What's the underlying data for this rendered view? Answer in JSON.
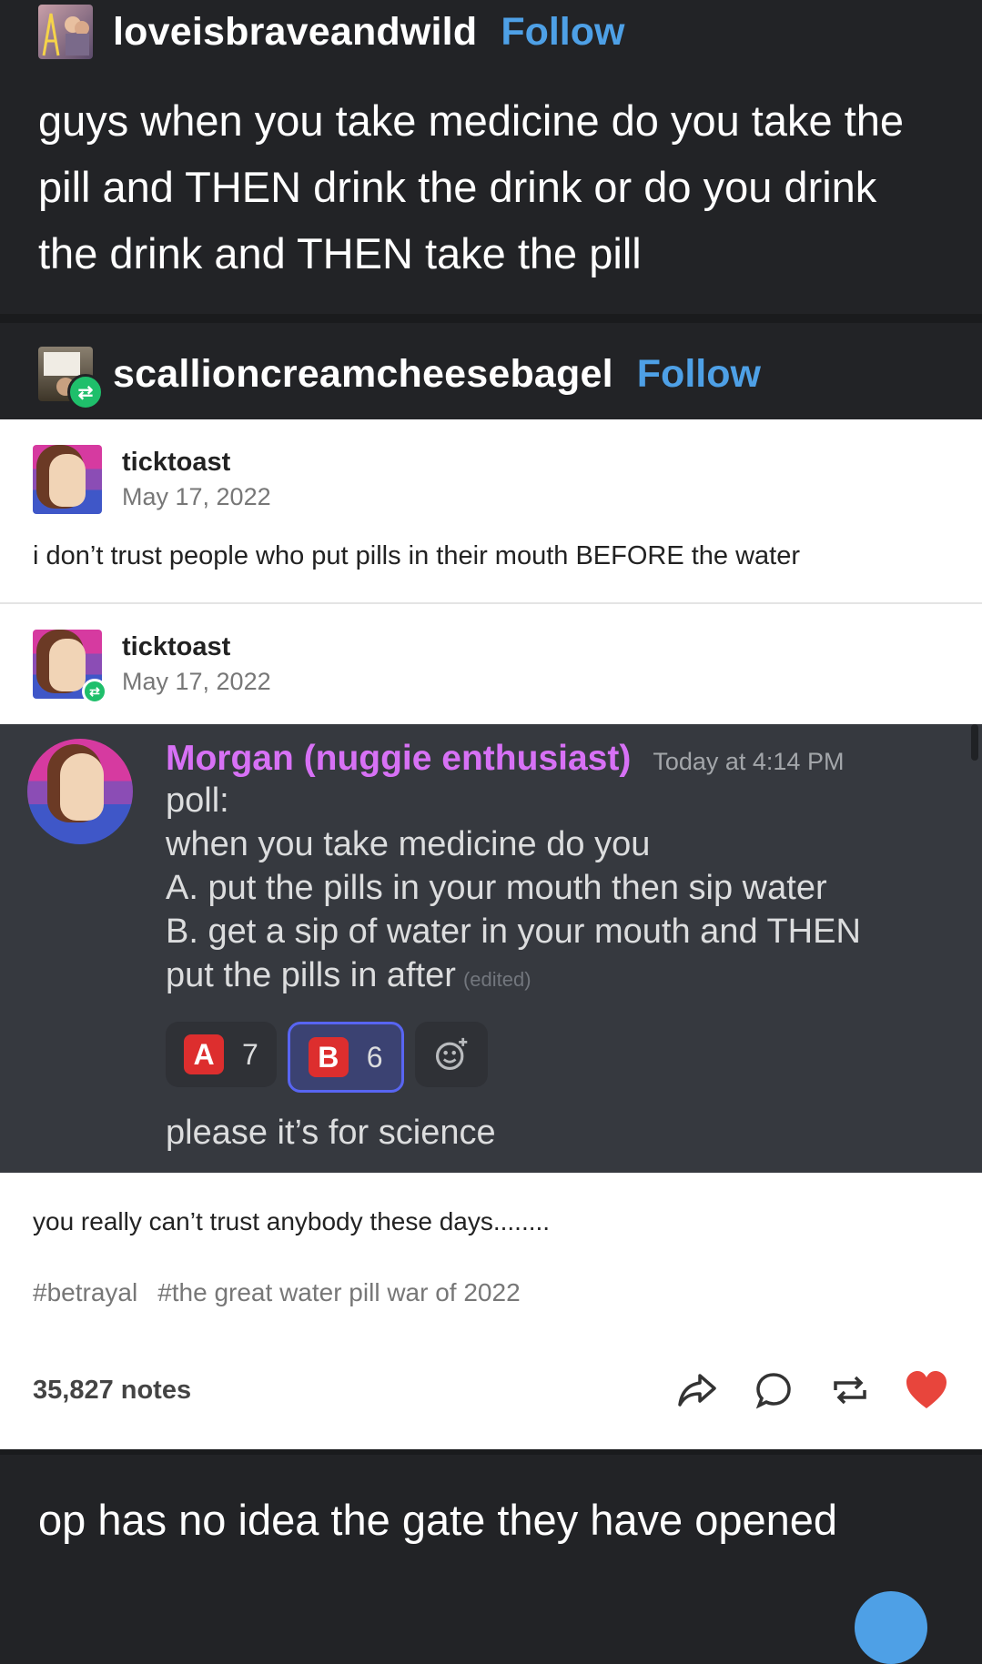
{
  "post1": {
    "username": "loveisbraveandwild",
    "follow_label": "Follow",
    "text": "guys when you take medicine do you take the pill and THEN drink the drink or do you drink the drink and THEN take the pill"
  },
  "post2": {
    "username": "scallioncreamcheesebagel",
    "follow_label": "Follow",
    "entries": [
      {
        "name": "ticktoast",
        "date": "May 17, 2022",
        "text": "i don’t trust people who put pills in their mouth BEFORE the water"
      },
      {
        "name": "ticktoast",
        "date": "May 17, 2022"
      }
    ],
    "discord": {
      "name": "Morgan (nuggie enthusiast)",
      "time": "Today at 4:14 PM",
      "lines": [
        "poll:",
        "when you take medicine do you",
        "A. put the pills in your mouth then sip water",
        "B. get a sip of water in your mouth and THEN",
        "put the pills in after"
      ],
      "edited": "(edited)",
      "reactions": [
        {
          "letter": "A",
          "count": "7"
        },
        {
          "letter": "B",
          "count": "6"
        }
      ],
      "footer": "please it’s for science"
    },
    "tail_text": "you really can’t trust anybody these days........",
    "tags": [
      "#betrayal",
      "#the great water pill war of 2022"
    ],
    "notes": "35,827 notes"
  },
  "post3": {
    "text": "op has no idea the gate they have opened"
  },
  "colors": {
    "follow": "#4ea0e6",
    "discord_name": "#d771f5",
    "heart": "#e8453c",
    "reblog_badge": "#1fbf6b"
  }
}
